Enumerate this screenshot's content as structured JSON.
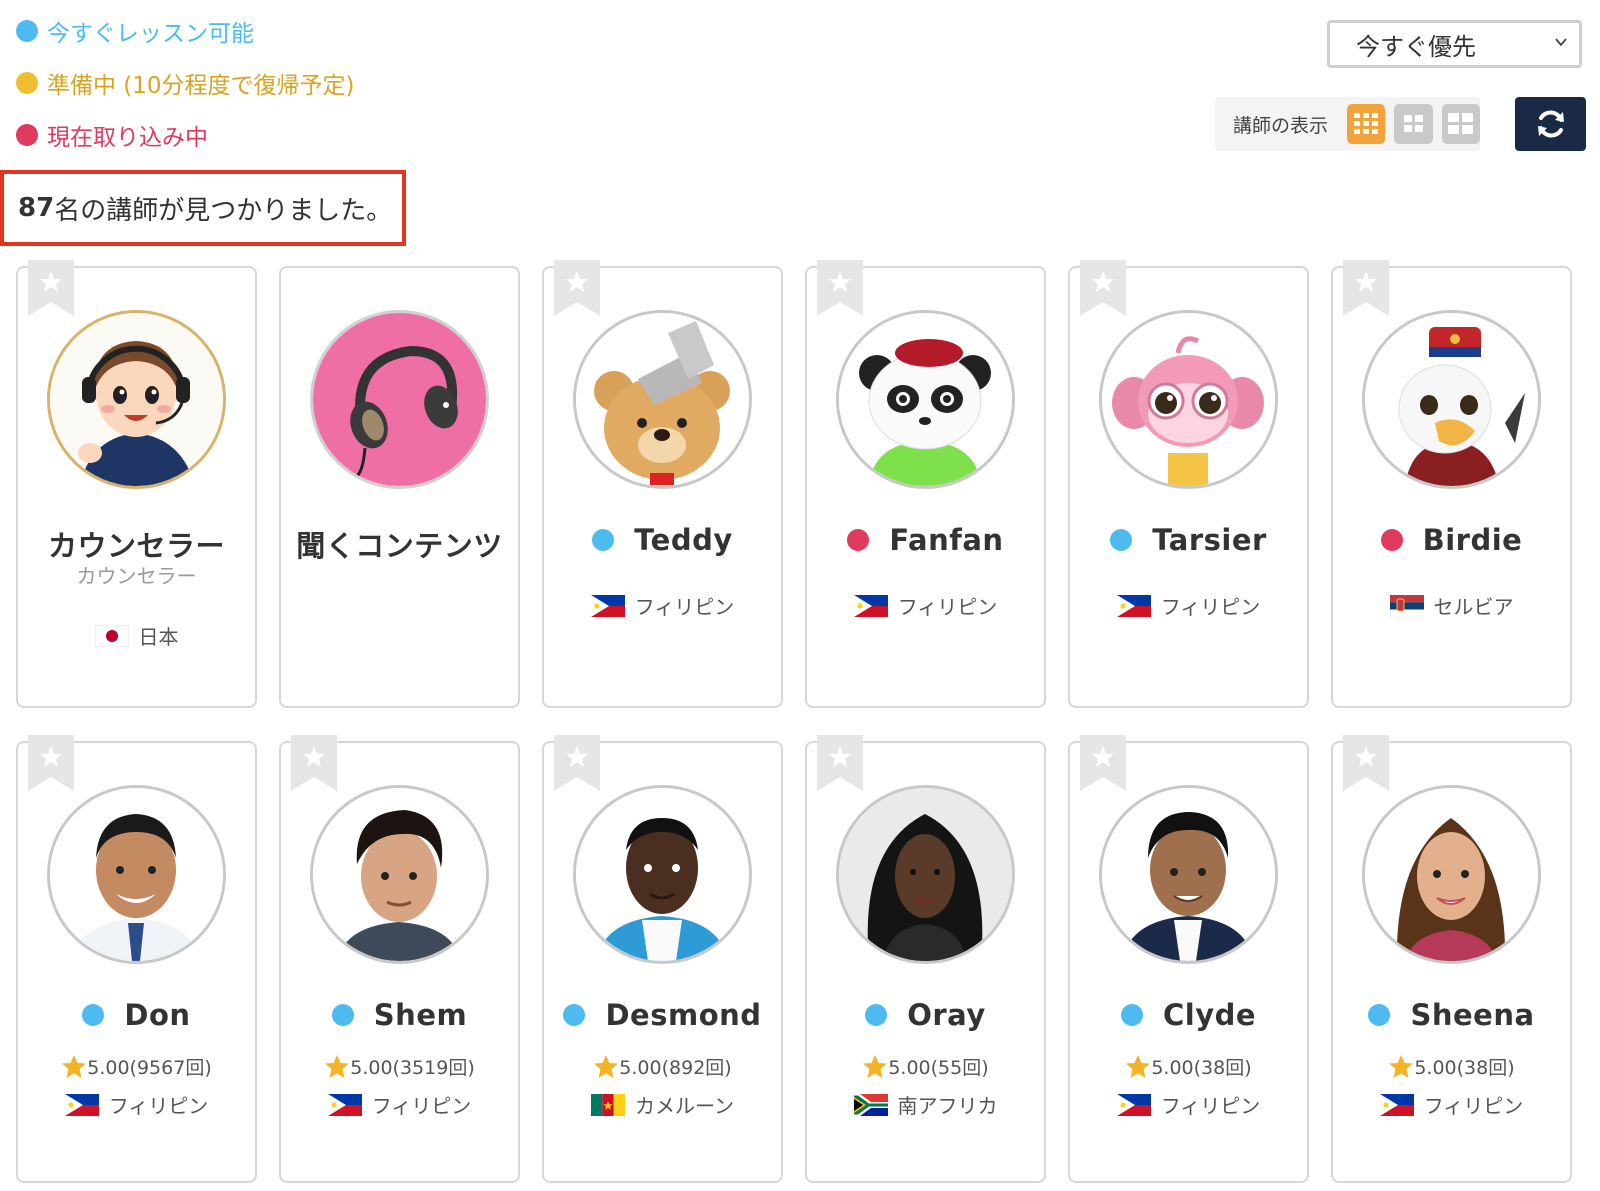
{
  "legend": [
    {
      "label": "今すぐレッスン可能",
      "color": "#4dbbf0"
    },
    {
      "label": "準備中 (10分程度で復帰予定)",
      "color": "#f0bd30"
    },
    {
      "label": "現在取り込み中",
      "color": "#e03a5c"
    }
  ],
  "sort": {
    "selected": "今すぐ優先"
  },
  "view_toggle": {
    "label": "講師の表示"
  },
  "results": {
    "count": "87",
    "suffix": "名の講師が見つかりました。"
  },
  "colors": {
    "available": "#4dbbf0",
    "busy": "#e03a5c",
    "accent": "#f2a33a",
    "highlight": "#e2341f",
    "refresh_bg": "#1b2a44"
  },
  "tutors_row1": [
    {
      "name": "カウンセラー",
      "subtitle": "カウンセラー",
      "country": "日本",
      "flag": "japan",
      "status": "none",
      "avatar": "counselor-illustration"
    },
    {
      "name": "聞くコンテンツ",
      "subtitle": "",
      "country": "",
      "flag": "",
      "status": "none",
      "avatar": "headphones-icon"
    },
    {
      "name": "Teddy",
      "subtitle": "",
      "country": "フィリピン",
      "flag": "philippines",
      "status": "available",
      "avatar": "bear-mascot"
    },
    {
      "name": "Fanfan",
      "subtitle": "",
      "country": "フィリピン",
      "flag": "philippines",
      "status": "busy",
      "avatar": "panda-mascot"
    },
    {
      "name": "Tarsier",
      "subtitle": "",
      "country": "フィリピン",
      "flag": "philippines",
      "status": "available",
      "avatar": "monkey-mascot"
    },
    {
      "name": "Birdie",
      "subtitle": "",
      "country": "セルビア",
      "flag": "serbia",
      "status": "busy",
      "avatar": "eagle-mascot"
    }
  ],
  "tutors_row2": [
    {
      "name": "Don",
      "rating": "5.00(9567回)",
      "country": "フィリピン",
      "flag": "philippines",
      "status": "available",
      "avatar": "tutor-photo"
    },
    {
      "name": "Shem",
      "rating": "5.00(3519回)",
      "country": "フィリピン",
      "flag": "philippines",
      "status": "available",
      "avatar": "tutor-photo"
    },
    {
      "name": "Desmond",
      "rating": "5.00(892回)",
      "country": "カメルーン",
      "flag": "cameroon",
      "status": "available",
      "avatar": "tutor-photo"
    },
    {
      "name": "Oray",
      "rating": "5.00(55回)",
      "country": "南アフリカ",
      "flag": "south-africa",
      "status": "available",
      "avatar": "tutor-photo"
    },
    {
      "name": "Clyde",
      "rating": "5.00(38回)",
      "country": "フィリピン",
      "flag": "philippines",
      "status": "available",
      "avatar": "tutor-photo"
    },
    {
      "name": "Sheena",
      "rating": "5.00(38回)",
      "country": "フィリピン",
      "flag": "philippines",
      "status": "available",
      "avatar": "tutor-photo"
    }
  ]
}
